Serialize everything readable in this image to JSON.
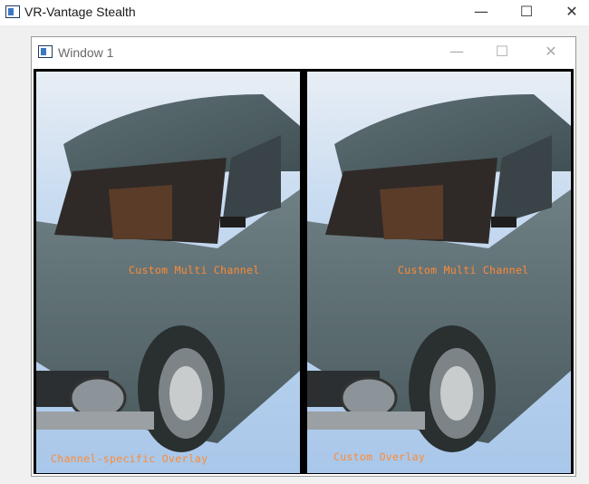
{
  "app": {
    "title": "VR-Vantage Stealth",
    "icon": "app-window-icon"
  },
  "window_controls": {
    "minimize": "—",
    "maximize": "☐",
    "close": "✕"
  },
  "child_window": {
    "title": "Window 1",
    "icon": "window-icon"
  },
  "child_controls": {
    "minimize": "—",
    "maximize": "☐",
    "close": "✕"
  },
  "viewports": [
    {
      "name": "left-viewport",
      "center_overlay": "Custom Multi Channel",
      "bottom_overlay": "Channel-specific Overlay"
    },
    {
      "name": "right-viewport",
      "center_overlay": "Custom Multi Channel",
      "bottom_overlay": "Custom Overlay"
    }
  ],
  "colors": {
    "overlay_text": "#ff8a33",
    "sky": "#b9d3ee",
    "car_body": "#5d6e72"
  }
}
